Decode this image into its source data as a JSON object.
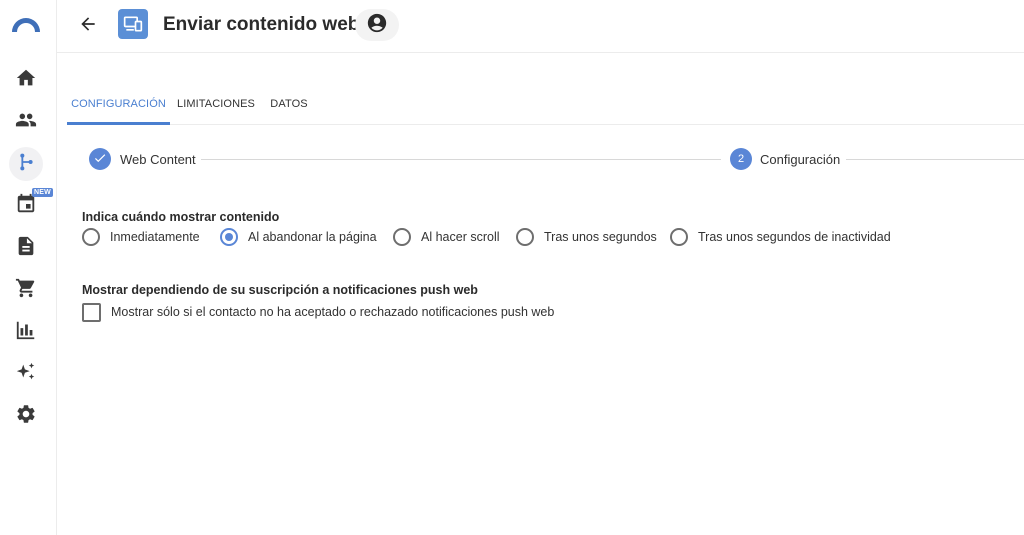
{
  "header": {
    "title": "Enviar contenido web"
  },
  "sidebar": {
    "new_badge": "NEW",
    "items": [
      {
        "icon": "home-icon"
      },
      {
        "icon": "people-icon"
      },
      {
        "icon": "flow-icon",
        "active": true
      },
      {
        "icon": "calendar-icon"
      },
      {
        "icon": "document-icon"
      },
      {
        "icon": "cart-icon"
      },
      {
        "icon": "bar-chart-icon"
      },
      {
        "icon": "sparkles-icon"
      },
      {
        "icon": "gear-icon"
      }
    ]
  },
  "tabs": [
    {
      "label": "CONFIGURACIÓN",
      "active": true
    },
    {
      "label": "LIMITACIONES"
    },
    {
      "label": "DATOS"
    }
  ],
  "stepper": {
    "step1_label": "Web Content",
    "step2_number": "2",
    "step2_label": "Configuración"
  },
  "display_section": {
    "title": "Indica cuándo mostrar contenido",
    "options": [
      {
        "label": "Inmediatamente",
        "selected": false
      },
      {
        "label": "Al abandonar la página",
        "selected": true
      },
      {
        "label": "Al hacer scroll",
        "selected": false
      },
      {
        "label": "Tras unos segundos",
        "selected": false
      },
      {
        "label": "Tras unos segundos de inactividad",
        "selected": false
      }
    ]
  },
  "push_section": {
    "title": "Mostrar dependiendo de su suscripción a notificaciones push web",
    "checkbox_label": "Mostrar sólo si el contacto no ha aceptado o rechazado notificaciones push web",
    "checked": false
  },
  "colors": {
    "accent": "#5a86d6",
    "tab_active": "#4a7fd0",
    "logo": "#3f6fb8"
  }
}
